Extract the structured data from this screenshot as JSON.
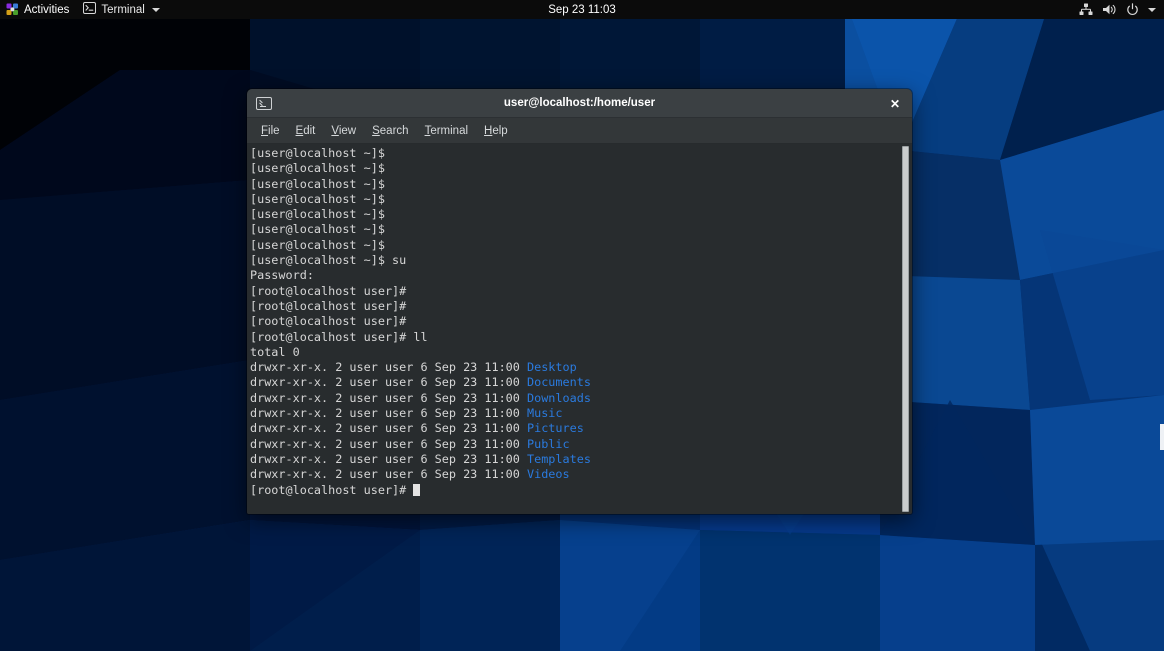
{
  "topbar": {
    "activities": {
      "label": "Activities",
      "icon": "activities-pinwheel-icon"
    },
    "app_menu": {
      "label": "Terminal",
      "icon": "terminal-icon",
      "caret": "chevron-down-icon"
    },
    "clock": "Sep 23  11:03",
    "system_icons": [
      "network-wired-icon",
      "volume-icon",
      "power-icon",
      "chevron-down-icon"
    ]
  },
  "window": {
    "icon": "terminal-icon",
    "title": "user@localhost:/home/user",
    "close_label": "✕",
    "menus": [
      {
        "label": "File",
        "mnemonic": "F",
        "rest": "ile"
      },
      {
        "label": "Edit",
        "mnemonic": "E",
        "rest": "dit"
      },
      {
        "label": "View",
        "mnemonic": "V",
        "rest": "iew"
      },
      {
        "label": "Search",
        "mnemonic": "S",
        "rest": "earch"
      },
      {
        "label": "Terminal",
        "mnemonic": "T",
        "rest": "erminal"
      },
      {
        "label": "Help",
        "mnemonic": "H",
        "rest": "elp"
      }
    ]
  },
  "terminal": {
    "prompt_user": "[user@localhost ~]$",
    "prompt_root": "[root@localhost user]#",
    "lines": [
      {
        "text": "[user@localhost ~]$"
      },
      {
        "text": "[user@localhost ~]$"
      },
      {
        "text": "[user@localhost ~]$"
      },
      {
        "text": "[user@localhost ~]$"
      },
      {
        "text": "[user@localhost ~]$"
      },
      {
        "text": "[user@localhost ~]$"
      },
      {
        "text": "[user@localhost ~]$"
      },
      {
        "text": "[user@localhost ~]$ su"
      },
      {
        "text": "Password:"
      },
      {
        "text": "[root@localhost user]#"
      },
      {
        "text": "[root@localhost user]#"
      },
      {
        "text": "[root@localhost user]#"
      },
      {
        "text": "[root@localhost user]# ll"
      },
      {
        "text": "total 0"
      },
      {
        "text": "drwxr-xr-x. 2 user user 6 Sep 23 11:00 ",
        "dir": "Desktop"
      },
      {
        "text": "drwxr-xr-x. 2 user user 6 Sep 23 11:00 ",
        "dir": "Documents"
      },
      {
        "text": "drwxr-xr-x. 2 user user 6 Sep 23 11:00 ",
        "dir": "Downloads"
      },
      {
        "text": "drwxr-xr-x. 2 user user 6 Sep 23 11:00 ",
        "dir": "Music"
      },
      {
        "text": "drwxr-xr-x. 2 user user 6 Sep 23 11:00 ",
        "dir": "Pictures"
      },
      {
        "text": "drwxr-xr-x. 2 user user 6 Sep 23 11:00 ",
        "dir": "Public"
      },
      {
        "text": "drwxr-xr-x. 2 user user 6 Sep 23 11:00 ",
        "dir": "Templates"
      },
      {
        "text": "drwxr-xr-x. 2 user user 6 Sep 23 11:00 ",
        "dir": "Videos"
      },
      {
        "text": "[root@localhost user]# ",
        "cursor": true
      }
    ]
  },
  "colors": {
    "topbar_bg": "#0b0b0b",
    "titlebar_bg": "#3b4043",
    "menubar_bg": "#333739",
    "terminal_bg": "#282c2e",
    "terminal_fg": "#d6d6d6",
    "directory_blue": "#2a7ade",
    "wallpaper_base": "#002a64"
  }
}
